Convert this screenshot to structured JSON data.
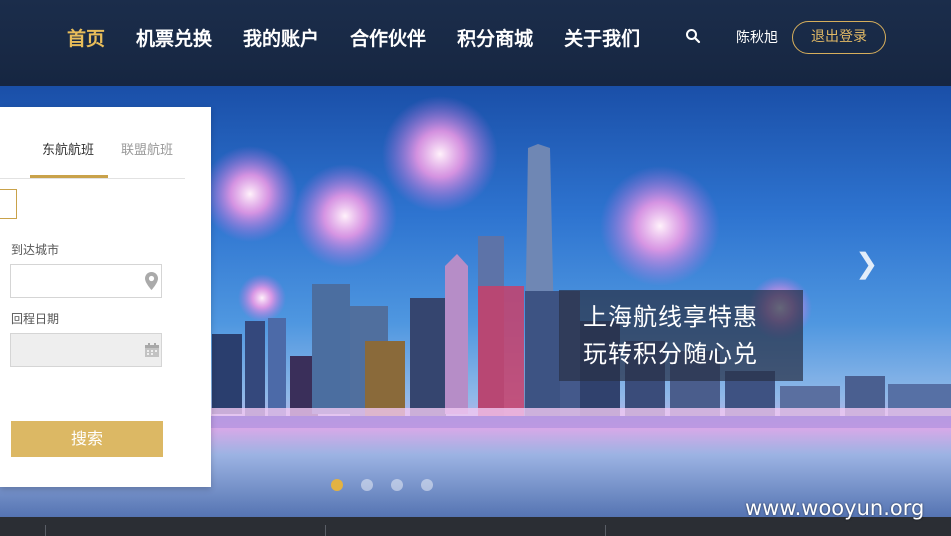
{
  "header": {
    "nav": [
      "首页",
      "机票兑换",
      "我的账户",
      "合作伙伴",
      "积分商城",
      "关于我们"
    ],
    "user_name": "陈秋旭",
    "logout_label": "退出登录"
  },
  "booking": {
    "tabs": [
      "东航航班",
      "联盟航班"
    ],
    "arrive_city_label": "到达城市",
    "return_date_label": "回程日期",
    "arrive_city_value": "",
    "return_date_value": "",
    "search_label": "搜索"
  },
  "banner": {
    "slogan_line1": "上海航线享特惠",
    "slogan_line2": "玩转积分随心兑",
    "next_symbol": "❯",
    "slide_count": 4,
    "active_slide": 1
  },
  "watermark": "www.wooyun.org",
  "colors": {
    "header_bg": "#1b2d4b",
    "accent_gold": "#e8bd5a",
    "button_gold": "#dcb864"
  }
}
